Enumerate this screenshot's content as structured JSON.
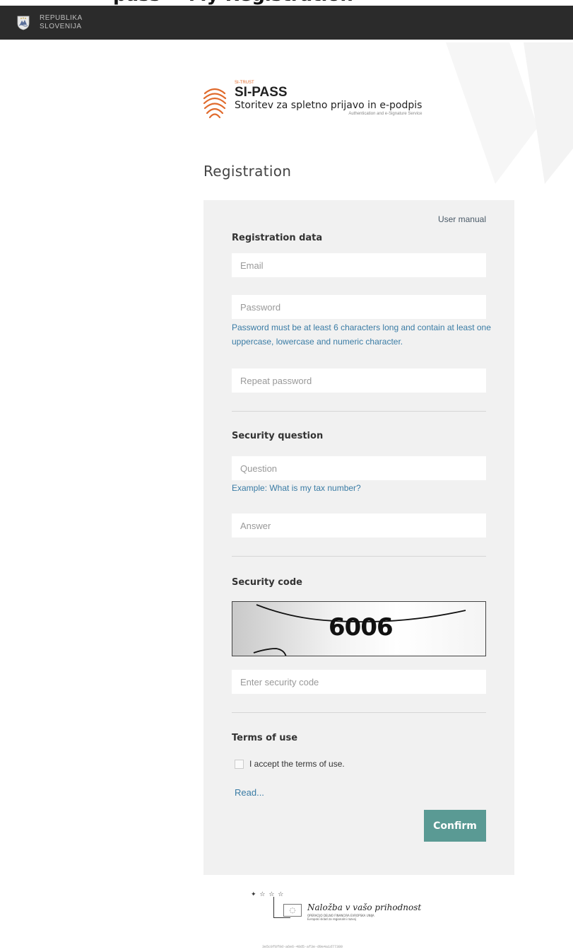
{
  "caption": "pass -- My Registration",
  "topbar": {
    "country_line1": "REPUBLIKA",
    "country_line2": "SLOVENIJA",
    "crest_icon": "slovenia-crest-icon"
  },
  "logo": {
    "small": "SI-TRUST",
    "name": "SI-PASS",
    "subtitle": "Storitev za spletno prijavo in e-podpis",
    "tagline": "Authentication and e-Signature Service",
    "icon": "fingerprint-icon",
    "color": "#e06a2c"
  },
  "heading": "Registration",
  "form": {
    "user_manual": "User manual",
    "registration_title": "Registration data",
    "email_placeholder": "Email",
    "password_placeholder": "Password",
    "password_hint": "Password must be at least 6 characters long and contain at least one uppercase, lowercase and numeric character.",
    "repeat_password_placeholder": "Repeat password",
    "security_question_title": "Security question",
    "question_placeholder": "Question",
    "question_hint": "Example: What is my tax number?",
    "answer_placeholder": "Answer",
    "security_code_title": "Security code",
    "captcha_value": "6006",
    "security_code_placeholder": "Enter security code",
    "terms_title": "Terms of use",
    "accept_terms_label": "I accept the terms of use.",
    "read_link": "Read...",
    "confirm_label": "Confirm",
    "accent_color": "#5a9a94",
    "link_color": "#3a7ca5"
  },
  "footer": {
    "eu_title": "Naložba v vašo prihodnost",
    "eu_subtitle": "OPERACIJO DELNO FINANCIRA EVROPSKA UNIJA",
    "eu_fund": "Evropski sklad za regionalni razvoj",
    "build_id": "3e5c0f8f9d-a6e6-48d5-af3e-d9e4a1d77380"
  }
}
